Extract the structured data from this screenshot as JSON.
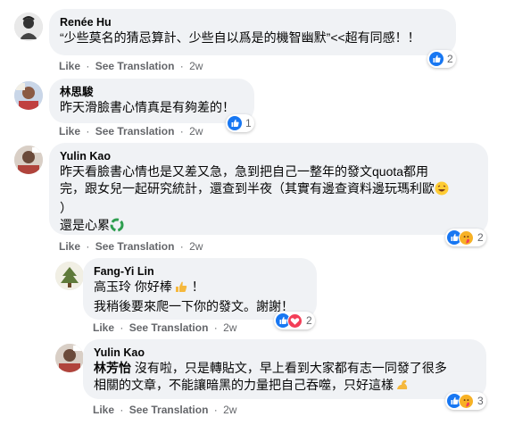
{
  "comments": [
    {
      "author": "Renée Hu",
      "lines": [
        "“少些莫名的猜忌算計、少些自以爲是的機智幽默”<<超有同感！！"
      ],
      "actions": {
        "like": "Like",
        "translate": "See Translation",
        "time": "2w"
      },
      "reaction_count": "2",
      "reaction_icons": [
        "like-icon"
      ]
    },
    {
      "author": "林思駿",
      "lines": [
        "昨天滑臉書心情真是有夠差的！"
      ],
      "actions": {
        "like": "Like",
        "translate": "See Translation",
        "time": "2w"
      },
      "reaction_count": "1",
      "reaction_icons": [
        "like-icon"
      ]
    },
    {
      "author": "Yulin Kao",
      "lines": [
        "昨天看臉書心情也是又差又急，急到把自己一整年的發文quota都用",
        "完，跟女兒一起研究統計，還查到半夜（其實有邊查資料邊玩瑪利歐",
        "）",
        "還是心累"
      ],
      "actions": {
        "like": "Like",
        "translate": "See Translation",
        "time": "2w"
      },
      "reaction_count": "2",
      "reaction_icons": [
        "like-icon",
        "care-icon"
      ]
    },
    {
      "author": "Fang-Yi Lin",
      "lines": [
        "高玉玲 你好棒",
        "我稍後要來爬一下你的發文。謝謝！"
      ],
      "actions": {
        "like": "Like",
        "translate": "See Translation",
        "time": "2w"
      },
      "reaction_count": "2",
      "reaction_icons": [
        "like-icon",
        "love-icon"
      ]
    },
    {
      "author": "Yulin Kao",
      "mention": "林芳怡",
      "lines": [
        " 沒有啦，只是轉貼文，早上看到大家都有志一同發了很多",
        "相關的文章，不能讓暗黑的力量把自己吞噬，只好這樣"
      ],
      "actions": {
        "like": "Like",
        "translate": "See Translation",
        "time": "2w"
      },
      "reaction_count": "3",
      "reaction_icons": [
        "like-icon",
        "care-icon"
      ]
    }
  ],
  "separator": "·",
  "colors": {
    "bubble": "#f0f2f5",
    "meta": "#65676b",
    "like_blue": "#1877f2",
    "love_red": "#f33e58",
    "care_yellow": "#f7b125"
  }
}
